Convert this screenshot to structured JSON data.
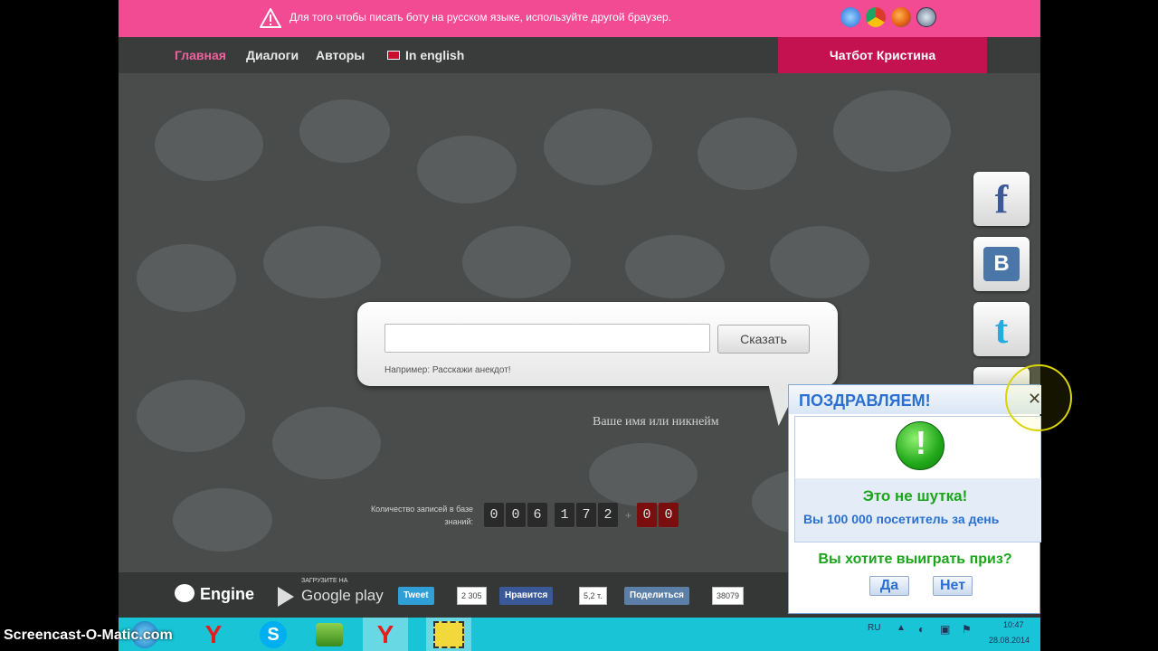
{
  "warning": {
    "text": "Для того чтобы писать боту на русском языке, используйте другой браузер."
  },
  "browsers": [
    "ie-icon",
    "chrome-icon",
    "firefox-icon",
    "safari-icon"
  ],
  "nav": {
    "items": [
      {
        "label": "Главная",
        "active": true
      },
      {
        "label": "Диалоги",
        "active": false
      },
      {
        "label": "Авторы",
        "active": false
      },
      {
        "label": "In english",
        "active": false
      }
    ],
    "chatbot_tab": "Чатбот Кристина"
  },
  "chat": {
    "input_value": "",
    "say_button": "Сказать",
    "example": "Например: Расскажи анекдот!",
    "nickname_label": "Ваше имя или никнейм"
  },
  "counter": {
    "label": "Количество записей в базе знаний:",
    "groups": [
      [
        "0",
        "0",
        "6"
      ],
      [
        "1",
        "7",
        "2"
      ]
    ],
    "plus": "+",
    "red_digits": [
      "0",
      "0"
    ]
  },
  "footer": {
    "engine": "Engine",
    "google_play_small": "ЗАГРУЗИТЕ НА",
    "google_play": "Google play",
    "tweet": "Tweet",
    "tweet_count": "2 305",
    "like": "Нравится",
    "like_count": "5,2 т.",
    "share": "Поделиться",
    "share_count": "38079"
  },
  "social": [
    "facebook-icon",
    "vk-icon",
    "twitter-icon"
  ],
  "popup": {
    "title": "ПОЗДРАВЛЯЕМ!",
    "joke": "Это не шутка!",
    "visitor": "Вы 100 000 посетитель за день",
    "question": "Вы хотите выиграть приз?",
    "yes": "Да",
    "no": "Нет"
  },
  "taskbar": {
    "lang": "RU",
    "time": "10:47",
    "date": "28.08.2014"
  },
  "watermark": "Screencast-O-Matic.com",
  "colors": {
    "pink_bar": "#f24a93",
    "chatbot_tab": "#c3124f",
    "taskbar": "#18c4d6",
    "popup_blue": "#2a6fd0",
    "popup_green": "#1aa51a"
  }
}
